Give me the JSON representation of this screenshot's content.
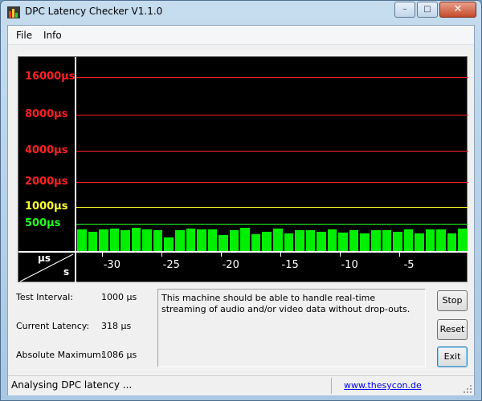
{
  "window": {
    "title": "DPC Latency Checker V1.1.0",
    "controls": {
      "minimize": "–",
      "maximize": "□",
      "close": "✕"
    }
  },
  "menu": [
    {
      "id": "file",
      "label": "File"
    },
    {
      "id": "info",
      "label": "Info"
    }
  ],
  "chart_data": {
    "type": "bar",
    "y_axis_labels": [
      {
        "label": "16000µs",
        "color": "#ff2020"
      },
      {
        "label": "8000µs",
        "color": "#ff2020"
      },
      {
        "label": "4000µs",
        "color": "#ff2020"
      },
      {
        "label": "2000µs",
        "color": "#ff2020"
      },
      {
        "label": "1000µs",
        "color": "#ffff30"
      },
      {
        "label": "500µs",
        "color": "#20ff20"
      }
    ],
    "y_unit_label": "µs",
    "x_unit_label": "s",
    "x_ticks": [
      "-30",
      "-25",
      "-20",
      "-15",
      "-10",
      "-5"
    ],
    "xlim": [
      -33,
      0
    ],
    "bar_color": "#00ee00",
    "values": [
      400,
      360,
      400,
      410,
      380,
      420,
      400,
      380,
      250,
      380,
      410,
      390,
      390,
      300,
      380,
      420,
      310,
      350,
      410,
      320,
      380,
      380,
      350,
      400,
      340,
      380,
      320,
      380,
      380,
      350,
      400,
      320,
      390,
      400,
      330,
      410
    ]
  },
  "info": [
    {
      "label": "Test Interval:",
      "value": "1000 µs"
    },
    {
      "label": "Current Latency:",
      "value": "318 µs"
    },
    {
      "label": "Absolute Maximum:",
      "value": "1086 µs"
    }
  ],
  "message": "This machine should be able to handle real-time streaming of audio and/or video data without drop-outs.",
  "buttons": {
    "stop": "Stop",
    "reset": "Reset",
    "exit": "Exit"
  },
  "status": {
    "text": "Analysing DPC latency ...",
    "link": "www.thesycon.de"
  }
}
